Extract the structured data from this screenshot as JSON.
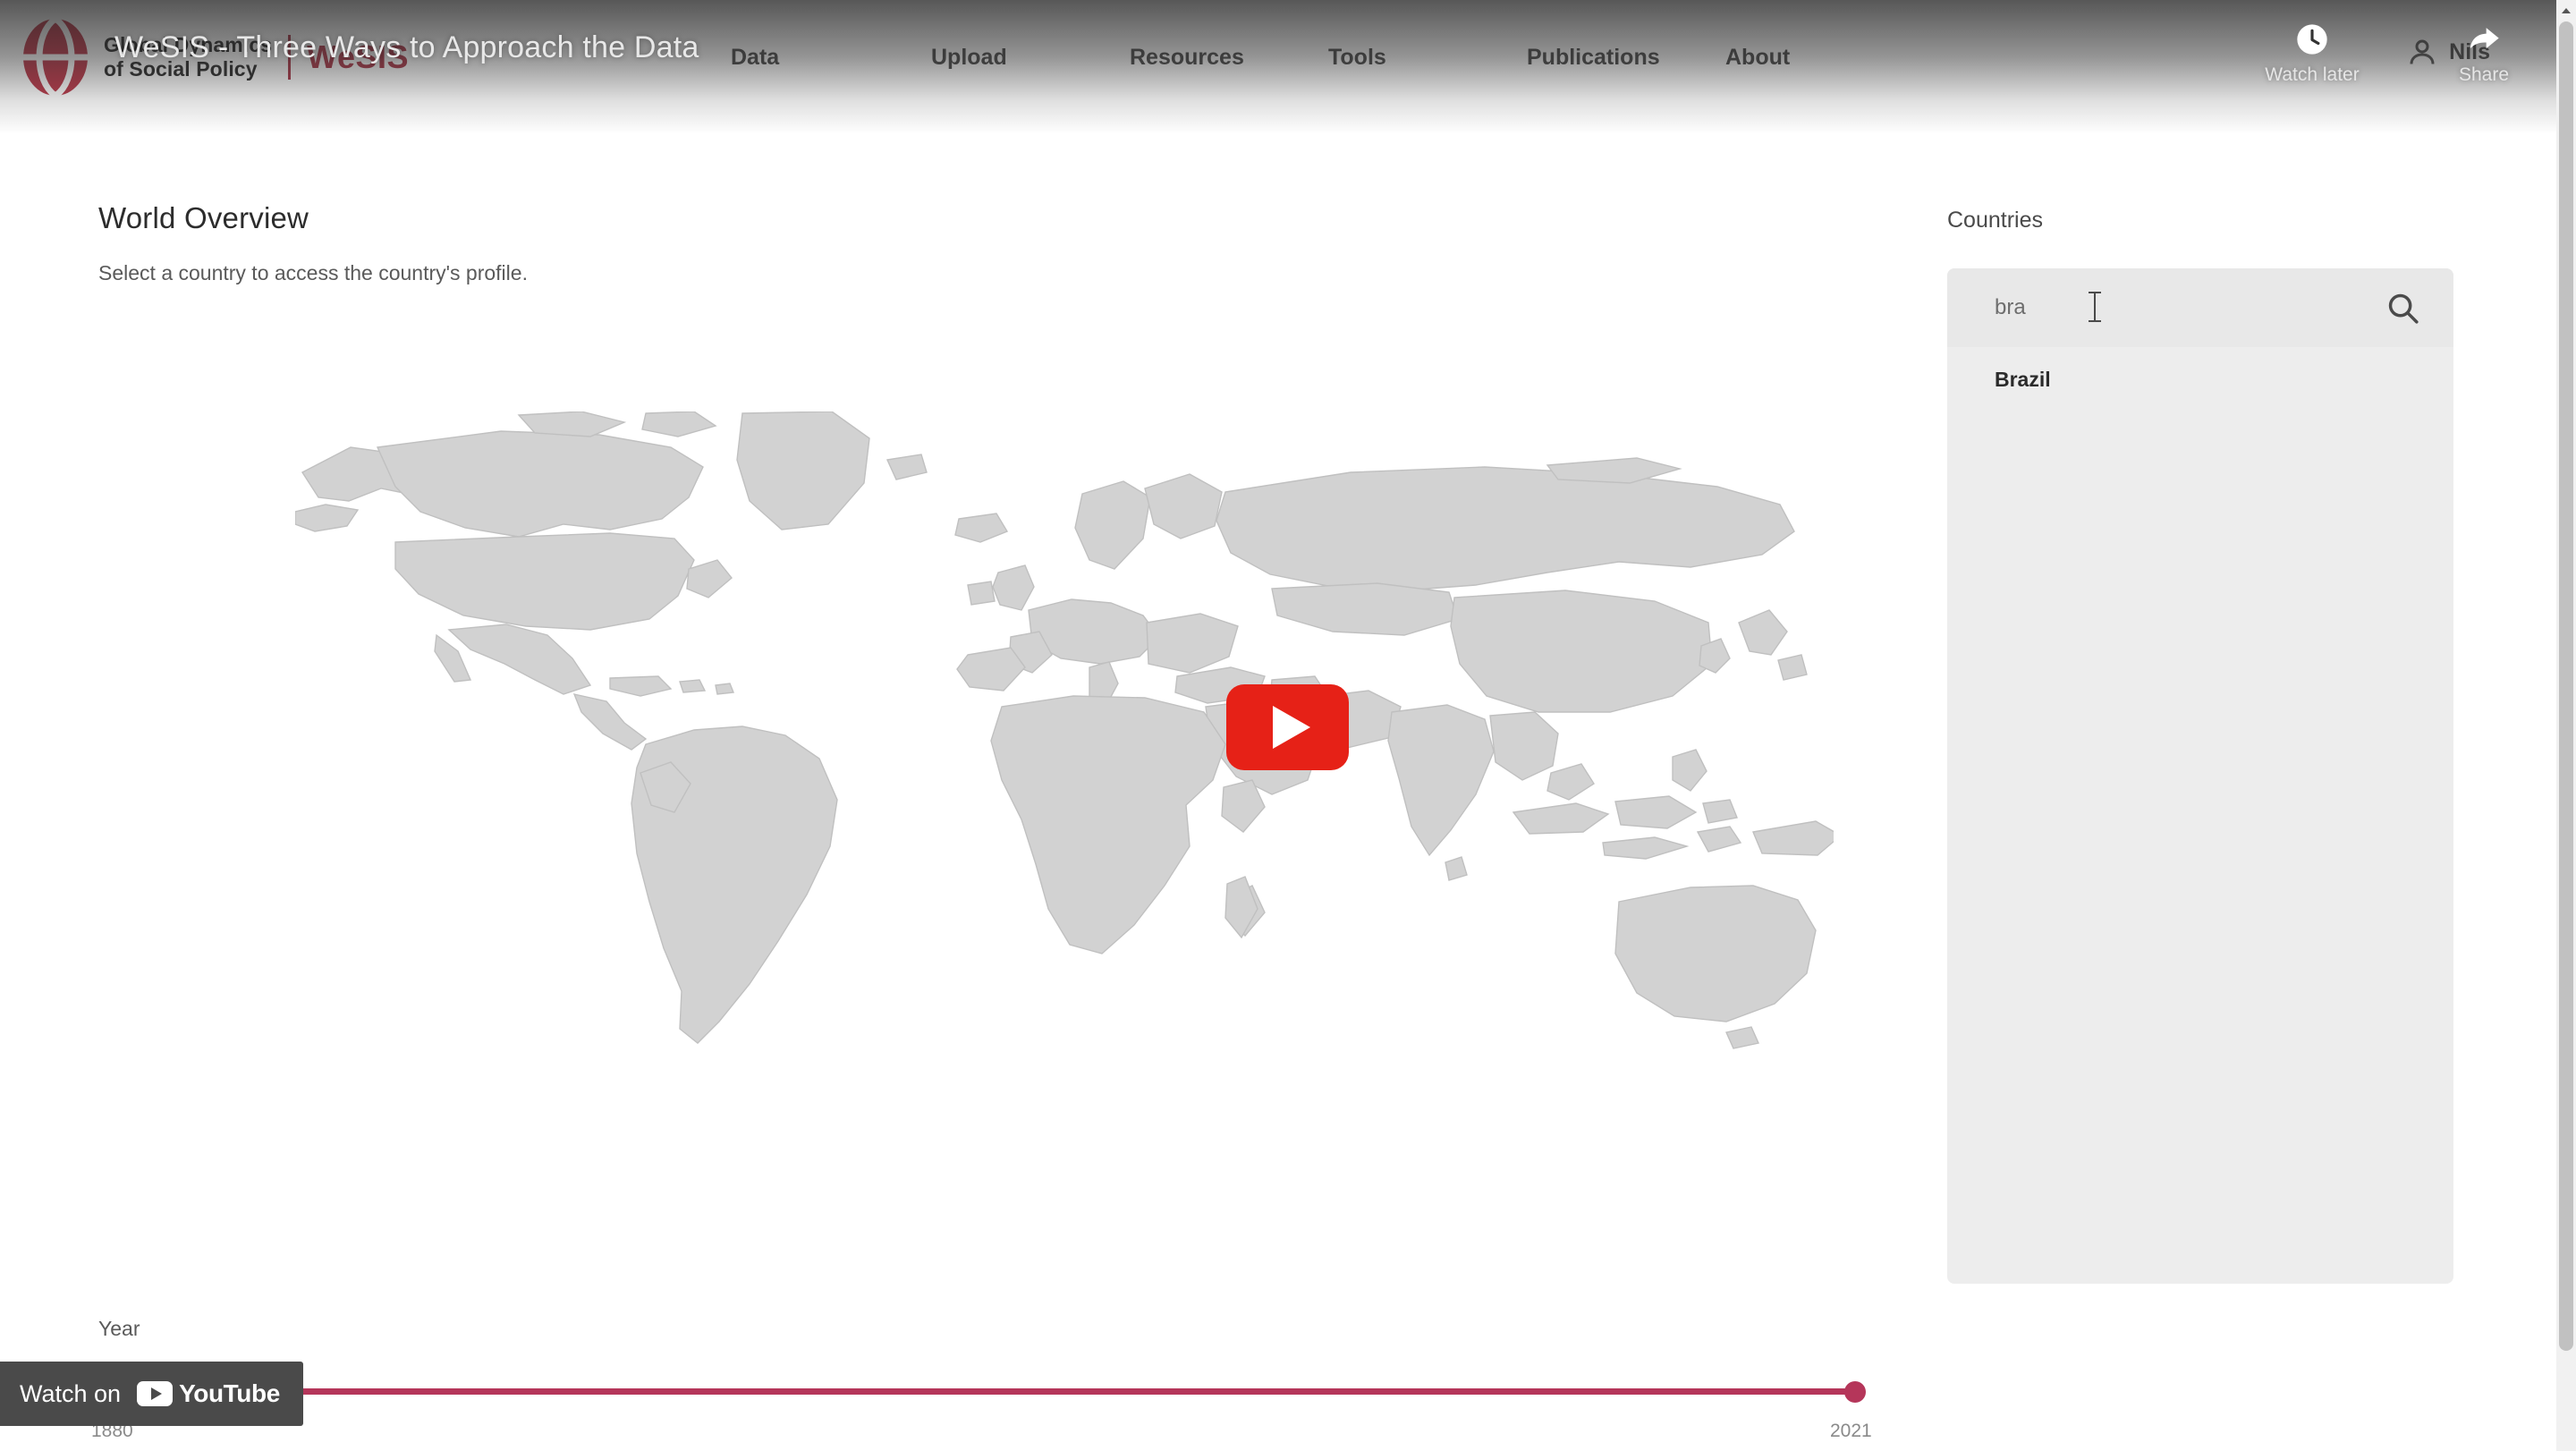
{
  "site": {
    "brand": {
      "line1": "Global Dynamics",
      "line2": "of Social Policy",
      "abbrev": "WeSIS",
      "logo_icon": "globe-icon"
    },
    "nav": [
      {
        "label": "Data"
      },
      {
        "label": "Upload"
      },
      {
        "label": "Resources"
      },
      {
        "label": "Tools"
      },
      {
        "label": "Publications"
      },
      {
        "label": "About"
      }
    ],
    "user": {
      "name": "Nils",
      "icon": "user-icon"
    },
    "main": {
      "title": "World Overview",
      "subtitle": "Select a country to access the country's profile."
    },
    "year_filter": {
      "label": "Year",
      "min_label": "1880",
      "max_label": "2021",
      "current_value": "2021",
      "accent_color": "#b5365a"
    },
    "countries": {
      "label": "Countries",
      "search": {
        "value": "bra",
        "placeholder": "",
        "icon": "search-icon"
      },
      "results": [
        {
          "name": "Brazil"
        }
      ]
    },
    "scrollbar": {
      "up_icon": "chevron-up-icon"
    }
  },
  "youtube": {
    "title": "WeSIS - Three Ways to Approach the Data",
    "actions": [
      {
        "label": "Watch later",
        "icon": "clock-icon"
      },
      {
        "label": "Share",
        "icon": "share-arrow-icon"
      }
    ],
    "play_button": {
      "icon": "play-icon",
      "color": "#e62117"
    },
    "watch_on": {
      "text": "Watch on",
      "brand": "YouTube",
      "icon": "youtube-logo-icon"
    }
  }
}
